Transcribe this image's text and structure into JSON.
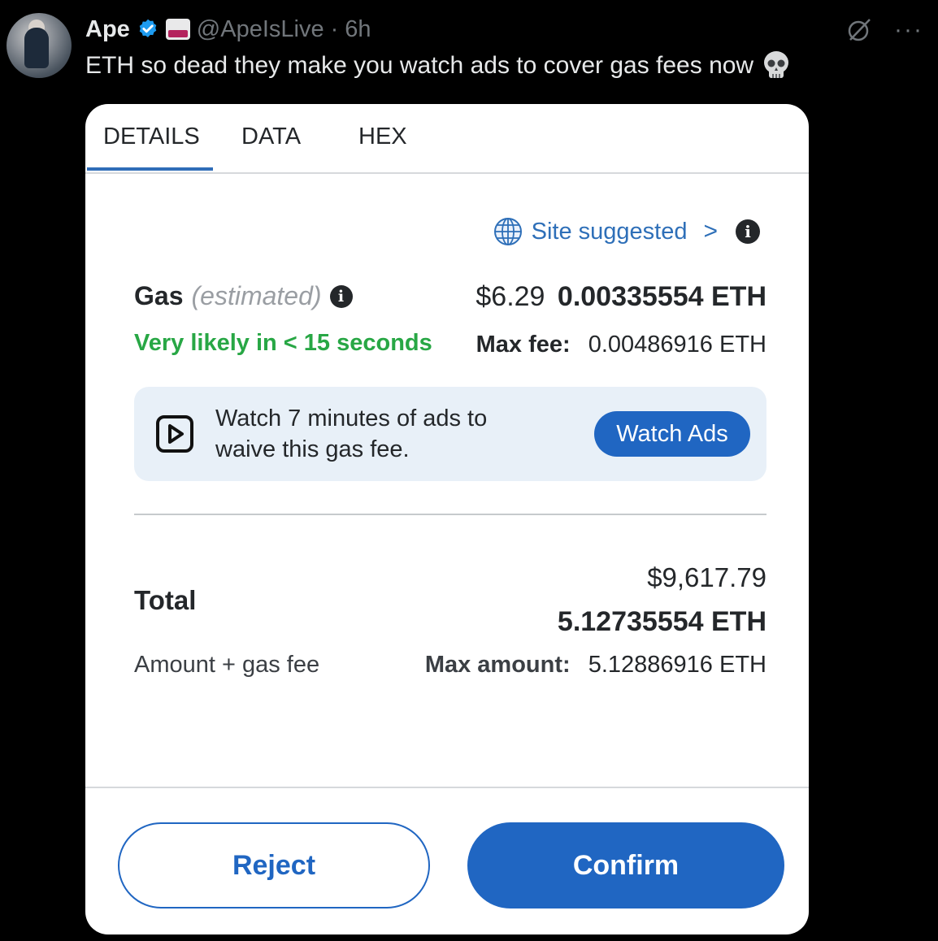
{
  "tweet": {
    "author_name": "Ape",
    "handle": "@ApeIsLive",
    "time": "· 6h",
    "text": "ETH so dead they make you watch ads to cover gas fees now"
  },
  "card": {
    "tabs": [
      "DETAILS",
      "DATA",
      "HEX"
    ],
    "active_tab": "DETAILS",
    "site_suggested": "Site suggested",
    "gas": {
      "label": "Gas",
      "estimated": "(estimated)",
      "usd": "$6.29",
      "eth": "0.00335554 ETH",
      "likely": "Very likely in < 15 seconds",
      "max_fee_label": "Max fee:",
      "max_fee_value": "0.00486916 ETH"
    },
    "ads": {
      "text": "Watch 7 minutes of ads to waive this gas fee.",
      "button": "Watch Ads"
    },
    "total": {
      "label": "Total",
      "usd": "$9,617.79",
      "eth": "5.12735554 ETH",
      "sub_label": "Amount + gas fee",
      "max_amount_label": "Max amount:",
      "max_amount_value": "5.12886916 ETH"
    },
    "buttons": {
      "reject": "Reject",
      "confirm": "Confirm"
    }
  },
  "colors": {
    "accent_blue": "#2066c2",
    "success_green": "#28a745",
    "verified_blue": "#1d9bf0"
  },
  "icons": [
    "verified-badge-icon",
    "skull-emoji-icon",
    "grok-icon",
    "more-icon",
    "globe-icon",
    "chevron-right-icon",
    "info-icon",
    "play-icon"
  ]
}
